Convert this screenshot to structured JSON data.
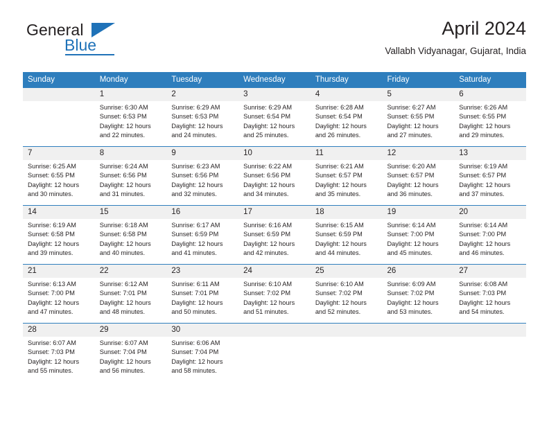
{
  "brand": {
    "name_part1": "General",
    "name_part2": "Blue",
    "accent_color": "#1f72b8"
  },
  "header": {
    "month_title": "April 2024",
    "location": "Vallabh Vidyanagar, Gujarat, India"
  },
  "calendar": {
    "header_color": "#2e7ebd",
    "daynum_bg": "#f0f0f0",
    "weekdays": [
      "Sunday",
      "Monday",
      "Tuesday",
      "Wednesday",
      "Thursday",
      "Friday",
      "Saturday"
    ],
    "weeks": [
      [
        {
          "day": "",
          "lines": []
        },
        {
          "day": "1",
          "lines": [
            "Sunrise: 6:30 AM",
            "Sunset: 6:53 PM",
            "Daylight: 12 hours",
            "and 22 minutes."
          ]
        },
        {
          "day": "2",
          "lines": [
            "Sunrise: 6:29 AM",
            "Sunset: 6:53 PM",
            "Daylight: 12 hours",
            "and 24 minutes."
          ]
        },
        {
          "day": "3",
          "lines": [
            "Sunrise: 6:29 AM",
            "Sunset: 6:54 PM",
            "Daylight: 12 hours",
            "and 25 minutes."
          ]
        },
        {
          "day": "4",
          "lines": [
            "Sunrise: 6:28 AM",
            "Sunset: 6:54 PM",
            "Daylight: 12 hours",
            "and 26 minutes."
          ]
        },
        {
          "day": "5",
          "lines": [
            "Sunrise: 6:27 AM",
            "Sunset: 6:55 PM",
            "Daylight: 12 hours",
            "and 27 minutes."
          ]
        },
        {
          "day": "6",
          "lines": [
            "Sunrise: 6:26 AM",
            "Sunset: 6:55 PM",
            "Daylight: 12 hours",
            "and 29 minutes."
          ]
        }
      ],
      [
        {
          "day": "7",
          "lines": [
            "Sunrise: 6:25 AM",
            "Sunset: 6:55 PM",
            "Daylight: 12 hours",
            "and 30 minutes."
          ]
        },
        {
          "day": "8",
          "lines": [
            "Sunrise: 6:24 AM",
            "Sunset: 6:56 PM",
            "Daylight: 12 hours",
            "and 31 minutes."
          ]
        },
        {
          "day": "9",
          "lines": [
            "Sunrise: 6:23 AM",
            "Sunset: 6:56 PM",
            "Daylight: 12 hours",
            "and 32 minutes."
          ]
        },
        {
          "day": "10",
          "lines": [
            "Sunrise: 6:22 AM",
            "Sunset: 6:56 PM",
            "Daylight: 12 hours",
            "and 34 minutes."
          ]
        },
        {
          "day": "11",
          "lines": [
            "Sunrise: 6:21 AM",
            "Sunset: 6:57 PM",
            "Daylight: 12 hours",
            "and 35 minutes."
          ]
        },
        {
          "day": "12",
          "lines": [
            "Sunrise: 6:20 AM",
            "Sunset: 6:57 PM",
            "Daylight: 12 hours",
            "and 36 minutes."
          ]
        },
        {
          "day": "13",
          "lines": [
            "Sunrise: 6:19 AM",
            "Sunset: 6:57 PM",
            "Daylight: 12 hours",
            "and 37 minutes."
          ]
        }
      ],
      [
        {
          "day": "14",
          "lines": [
            "Sunrise: 6:19 AM",
            "Sunset: 6:58 PM",
            "Daylight: 12 hours",
            "and 39 minutes."
          ]
        },
        {
          "day": "15",
          "lines": [
            "Sunrise: 6:18 AM",
            "Sunset: 6:58 PM",
            "Daylight: 12 hours",
            "and 40 minutes."
          ]
        },
        {
          "day": "16",
          "lines": [
            "Sunrise: 6:17 AM",
            "Sunset: 6:59 PM",
            "Daylight: 12 hours",
            "and 41 minutes."
          ]
        },
        {
          "day": "17",
          "lines": [
            "Sunrise: 6:16 AM",
            "Sunset: 6:59 PM",
            "Daylight: 12 hours",
            "and 42 minutes."
          ]
        },
        {
          "day": "18",
          "lines": [
            "Sunrise: 6:15 AM",
            "Sunset: 6:59 PM",
            "Daylight: 12 hours",
            "and 44 minutes."
          ]
        },
        {
          "day": "19",
          "lines": [
            "Sunrise: 6:14 AM",
            "Sunset: 7:00 PM",
            "Daylight: 12 hours",
            "and 45 minutes."
          ]
        },
        {
          "day": "20",
          "lines": [
            "Sunrise: 6:14 AM",
            "Sunset: 7:00 PM",
            "Daylight: 12 hours",
            "and 46 minutes."
          ]
        }
      ],
      [
        {
          "day": "21",
          "lines": [
            "Sunrise: 6:13 AM",
            "Sunset: 7:00 PM",
            "Daylight: 12 hours",
            "and 47 minutes."
          ]
        },
        {
          "day": "22",
          "lines": [
            "Sunrise: 6:12 AM",
            "Sunset: 7:01 PM",
            "Daylight: 12 hours",
            "and 48 minutes."
          ]
        },
        {
          "day": "23",
          "lines": [
            "Sunrise: 6:11 AM",
            "Sunset: 7:01 PM",
            "Daylight: 12 hours",
            "and 50 minutes."
          ]
        },
        {
          "day": "24",
          "lines": [
            "Sunrise: 6:10 AM",
            "Sunset: 7:02 PM",
            "Daylight: 12 hours",
            "and 51 minutes."
          ]
        },
        {
          "day": "25",
          "lines": [
            "Sunrise: 6:10 AM",
            "Sunset: 7:02 PM",
            "Daylight: 12 hours",
            "and 52 minutes."
          ]
        },
        {
          "day": "26",
          "lines": [
            "Sunrise: 6:09 AM",
            "Sunset: 7:02 PM",
            "Daylight: 12 hours",
            "and 53 minutes."
          ]
        },
        {
          "day": "27",
          "lines": [
            "Sunrise: 6:08 AM",
            "Sunset: 7:03 PM",
            "Daylight: 12 hours",
            "and 54 minutes."
          ]
        }
      ],
      [
        {
          "day": "28",
          "lines": [
            "Sunrise: 6:07 AM",
            "Sunset: 7:03 PM",
            "Daylight: 12 hours",
            "and 55 minutes."
          ]
        },
        {
          "day": "29",
          "lines": [
            "Sunrise: 6:07 AM",
            "Sunset: 7:04 PM",
            "Daylight: 12 hours",
            "and 56 minutes."
          ]
        },
        {
          "day": "30",
          "lines": [
            "Sunrise: 6:06 AM",
            "Sunset: 7:04 PM",
            "Daylight: 12 hours",
            "and 58 minutes."
          ]
        },
        {
          "day": "",
          "lines": []
        },
        {
          "day": "",
          "lines": []
        },
        {
          "day": "",
          "lines": []
        },
        {
          "day": "",
          "lines": []
        }
      ]
    ]
  }
}
